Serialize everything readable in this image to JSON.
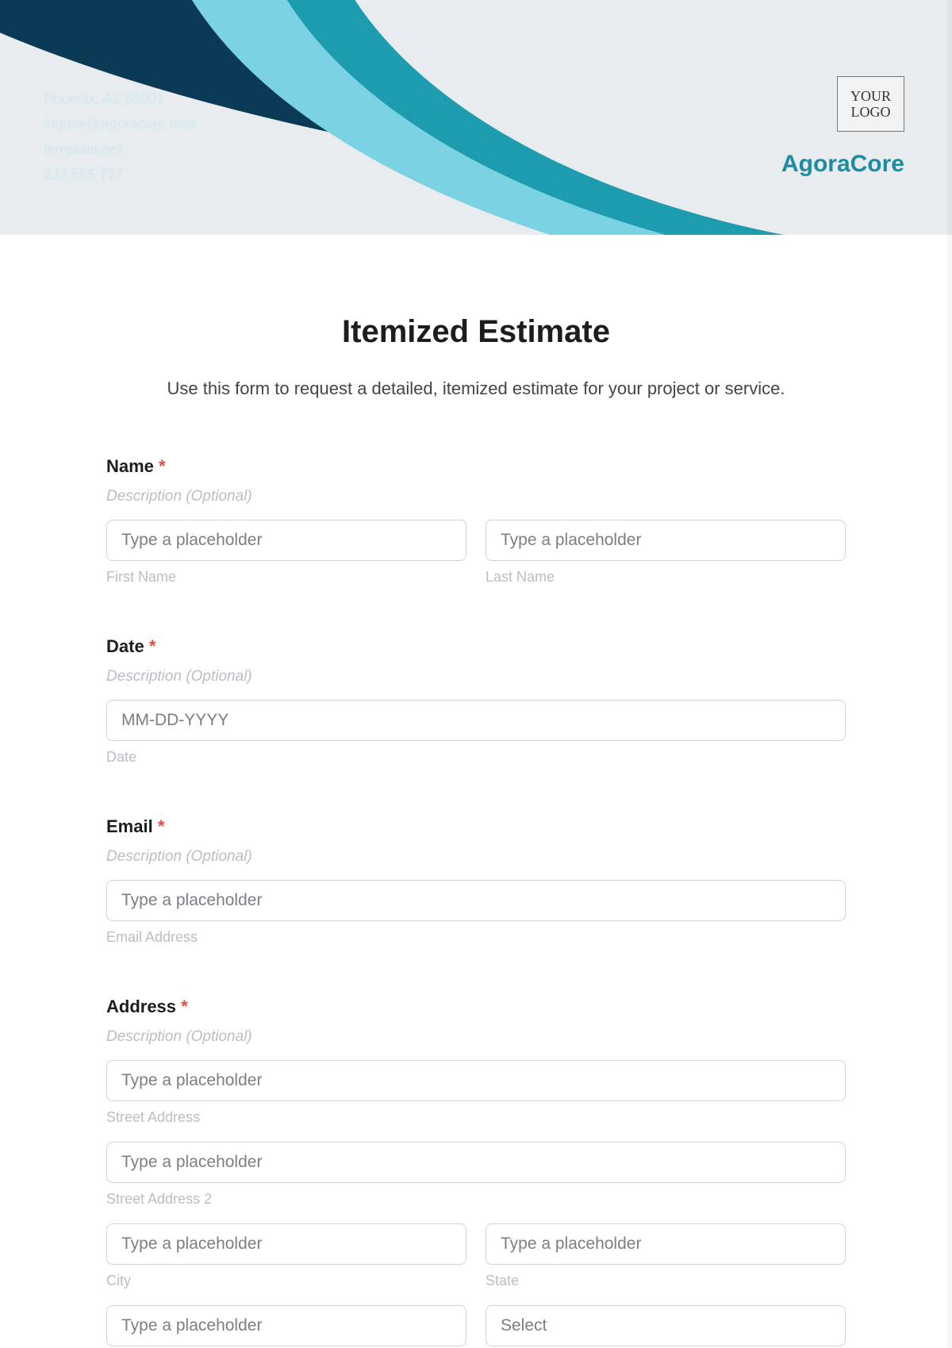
{
  "header": {
    "contact": {
      "line1": "Phoenix, AZ 85001",
      "line2": "inquire@agoracore.mail",
      "line3": "template.net",
      "line4": "222 555 777"
    },
    "logo_text": "YOUR LOGO",
    "company": "AgoraCore"
  },
  "form": {
    "title": "Itemized Estimate",
    "subtitle": "Use this form to request a detailed, itemized estimate for your project or service.",
    "desc_optional": "Description (Optional)",
    "required_mark": "*",
    "name": {
      "label": "Name",
      "first_ph": "Type a placeholder",
      "first_sub": "First Name",
      "last_ph": "Type a placeholder",
      "last_sub": "Last Name"
    },
    "date": {
      "label": "Date",
      "ph": "MM-DD-YYYY",
      "sub": "Date"
    },
    "email": {
      "label": "Email",
      "ph": "Type a placeholder",
      "sub": "Email Address"
    },
    "address": {
      "label": "Address",
      "street_ph": "Type a placeholder",
      "street_sub": "Street Address",
      "street2_ph": "Type a placeholder",
      "street2_sub": "Street Address 2",
      "city_ph": "Type a placeholder",
      "city_sub": "City",
      "state_ph": "Type a placeholder",
      "state_sub": "State",
      "zip_ph": "Type a placeholder",
      "country_ph": "Select"
    }
  }
}
